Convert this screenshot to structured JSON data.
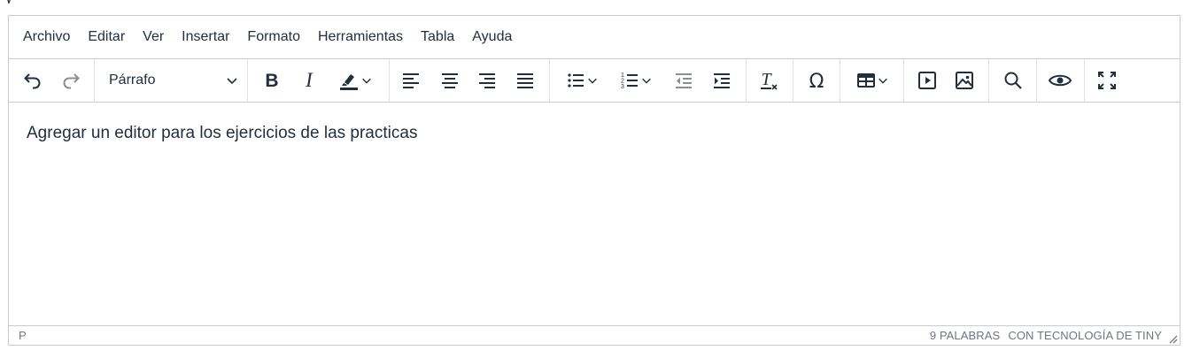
{
  "page_heading_fragment": "y",
  "menubar": {
    "items": [
      "Archivo",
      "Editar",
      "Ver",
      "Insertar",
      "Formato",
      "Herramientas",
      "Tabla",
      "Ayuda"
    ]
  },
  "toolbar": {
    "block_format": "Párrafo",
    "icons": [
      "undo-icon",
      "redo-icon",
      "bold-icon",
      "italic-icon",
      "highlight-icon",
      "align-left-icon",
      "align-center-icon",
      "align-right-icon",
      "justify-icon",
      "bullet-list-icon",
      "numbered-list-icon",
      "outdent-icon",
      "indent-icon",
      "clear-formatting-icon",
      "special-character-icon",
      "table-icon",
      "media-icon",
      "image-icon",
      "search-icon",
      "preview-icon",
      "fullscreen-icon"
    ]
  },
  "content": {
    "text": "Agregar un editor para los ejercicios de las practicas"
  },
  "statusbar": {
    "path": "P",
    "word_count": "9 PALABRAS",
    "branding": "CON TECNOLOGÍA DE TINY"
  },
  "colors": {
    "text": "#222f3e",
    "border": "#cccccc",
    "disabled_icon": "#8a8f97",
    "status_text": "#6e7682"
  }
}
